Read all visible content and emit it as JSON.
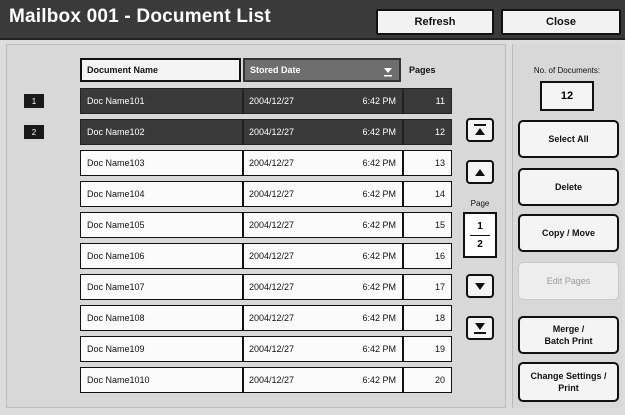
{
  "window": {
    "title": "Mailbox 001 - Document List",
    "refresh_label": "Refresh",
    "close_label": "Close"
  },
  "table": {
    "headers": {
      "name": "Document Name",
      "date": "Stored Date",
      "pages": "Pages"
    },
    "selected_markers": [
      "1",
      "2"
    ],
    "rows": [
      {
        "name": "Doc Name101",
        "date": "2004/12/27",
        "time": "6:42 PM",
        "pages": "11",
        "selected": true
      },
      {
        "name": "Doc Name102",
        "date": "2004/12/27",
        "time": "6:42 PM",
        "pages": "12",
        "selected": true
      },
      {
        "name": "Doc Name103",
        "date": "2004/12/27",
        "time": "6:42 PM",
        "pages": "13",
        "selected": false
      },
      {
        "name": "Doc Name104",
        "date": "2004/12/27",
        "time": "6:42 PM",
        "pages": "14",
        "selected": false
      },
      {
        "name": "Doc Name105",
        "date": "2004/12/27",
        "time": "6:42 PM",
        "pages": "15",
        "selected": false
      },
      {
        "name": "Doc Name106",
        "date": "2004/12/27",
        "time": "6:42 PM",
        "pages": "16",
        "selected": false
      },
      {
        "name": "Doc Name107",
        "date": "2004/12/27",
        "time": "6:42 PM",
        "pages": "17",
        "selected": false
      },
      {
        "name": "Doc Name108",
        "date": "2004/12/27",
        "time": "6:42 PM",
        "pages": "18",
        "selected": false
      },
      {
        "name": "Doc Name109",
        "date": "2004/12/27",
        "time": "6:42 PM",
        "pages": "19",
        "selected": false
      },
      {
        "name": "Doc Name1010",
        "date": "2004/12/27",
        "time": "6:42 PM",
        "pages": "20",
        "selected": false
      }
    ]
  },
  "pager": {
    "label": "Page",
    "current": "1",
    "total": "2"
  },
  "side": {
    "docs_label": "No. of Documents:",
    "docs_count": "12",
    "select_all": "Select All",
    "delete": "Delete",
    "copy_move": "Copy / Move",
    "edit_pages": "Edit Pages",
    "merge_line1": "Merge /",
    "merge_line2": "Batch Print",
    "change_line1": "Change Settings /",
    "change_line2": "Print"
  },
  "icons": {
    "sort": "sort-descending-icon",
    "first": "scroll-top-icon",
    "up": "scroll-up-icon",
    "down": "scroll-down-icon",
    "last": "scroll-bottom-icon"
  },
  "colors": {
    "title_bar": "#3a3a3a",
    "selected_row": "#3a3a3a",
    "sorted_header": "#6e6e6e"
  }
}
